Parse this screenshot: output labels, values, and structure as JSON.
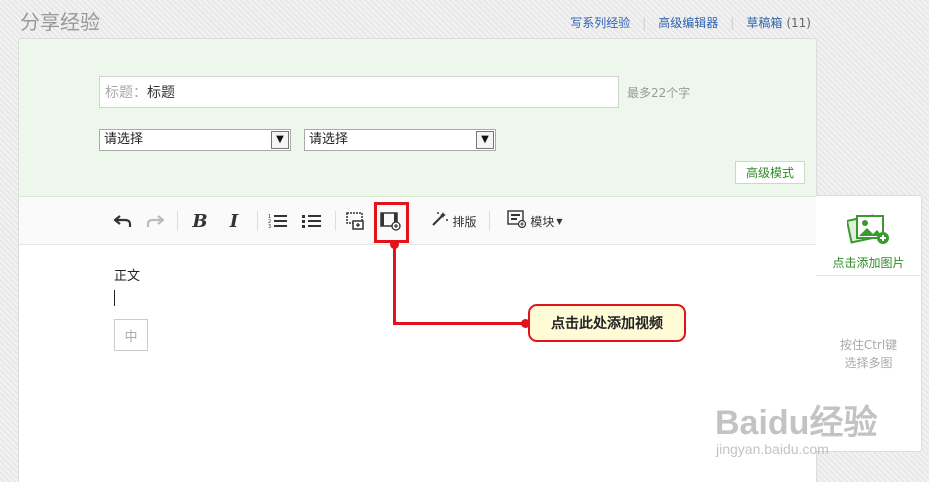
{
  "header": {
    "title": "分享经验",
    "links": [
      {
        "label": "写系列经验"
      },
      {
        "label": "高级编辑器"
      },
      {
        "label": "草稿箱",
        "count": "(11)"
      }
    ]
  },
  "form": {
    "title_prefix": "标题：",
    "title_value": "标题",
    "title_hint": "最多22个字",
    "select1_value": "请选择",
    "select2_value": "请选择",
    "advanced_mode_label": "高级模式"
  },
  "toolbar": {
    "layout_label": "排版",
    "module_label": "模块"
  },
  "editor": {
    "body_text": "正文",
    "zh_label": "中"
  },
  "side": {
    "add_image_label": "点击添加图片",
    "hint_line1": "按住Ctrl键",
    "hint_line2": "选择多图"
  },
  "annotation": {
    "callout_text": "点击此处添加视频"
  },
  "watermark": {
    "brand": "Baidu经验",
    "url": "jingyan.baidu.com"
  },
  "colors": {
    "accent_green": "#2d8b24",
    "link_blue": "#2d64b3",
    "annotation_red": "#e0141a",
    "header_bg": "#eef7ec"
  }
}
